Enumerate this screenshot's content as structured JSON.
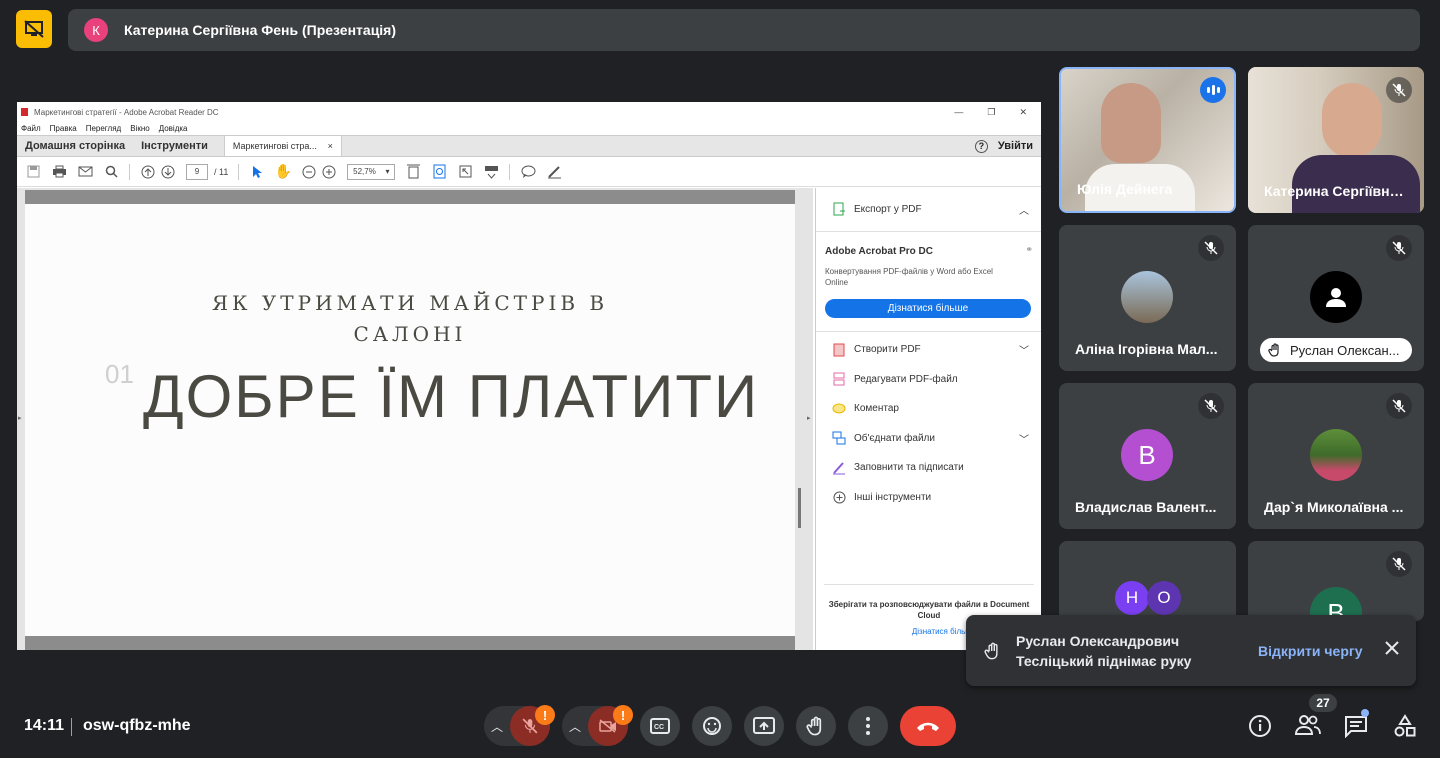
{
  "meeting": {
    "presenter_title": "Катерина Сергіївна Фень (Презентація)",
    "presenter_initial": "К",
    "time": "14:11",
    "meeting_code": "osw-qfbz-mhe",
    "participant_count": "27"
  },
  "acrobat": {
    "window_title": "Маркетингові стратегії - Adobe Acrobat Reader DC",
    "menu": [
      "Файл",
      "Правка",
      "Перегляд",
      "Вікно",
      "Довідка"
    ],
    "tabs": {
      "home": "Домашня сторінка",
      "tools": "Інструменти",
      "doc": "Маркетингові стра...",
      "close": "×"
    },
    "signin": "Увійти",
    "page_current": "9",
    "page_total": "/ 11",
    "zoom": "52,7%",
    "slide": {
      "subtitle_line1": "ЯК УТРИМАТИ МАЙСТРІВ В",
      "subtitle_line2": "САЛОНІ",
      "number": "01",
      "headline": "ДОБРЕ ЇМ ПЛАТИТИ"
    },
    "sidepanel": {
      "export_label": "Експорт у PDF",
      "product_title": "Adobe Acrobat Pro DC",
      "product_desc": "Конвертування PDF-файлів у Word або Excel Online",
      "learn_more_button": "Дізнатися більше",
      "tools": [
        "Створити PDF",
        "Редагувати PDF-файл",
        "Коментар",
        "Об'єднати файли",
        "Заповнити та підписати",
        "Інші інструменти"
      ],
      "cloud_text": "Зберігати та розповсюджувати файли в Document Cloud",
      "cloud_link": "Дізнатися більше"
    }
  },
  "participants": [
    {
      "name": "Юлія Дейнега",
      "speaking": true
    },
    {
      "name": "Катерина Сергіївна..."
    },
    {
      "name": "Аліна Ігорівна Мал..."
    },
    {
      "name": "Руслан Олексан..."
    },
    {
      "name": "Владислав Валент...",
      "initial": "В",
      "color": "#b34fd0"
    },
    {
      "name": "Дар`я Миколаївна ..."
    },
    {
      "initials": [
        "Н",
        "О"
      ],
      "colors": [
        "#7b3ff2",
        "#5e35b1"
      ]
    },
    {
      "initial": "В",
      "color": "#1e6f50"
    }
  ],
  "toast": {
    "message_line1": "Руслан Олександрович",
    "message_line2": "Тесліцький піднімає руку",
    "action": "Відкрити чергу"
  },
  "colors": {
    "background": "#202124",
    "tile": "#3c4043",
    "end_call": "#ea4335",
    "accent_blue": "#8ab4f8",
    "presenting": "#fbbc04"
  }
}
